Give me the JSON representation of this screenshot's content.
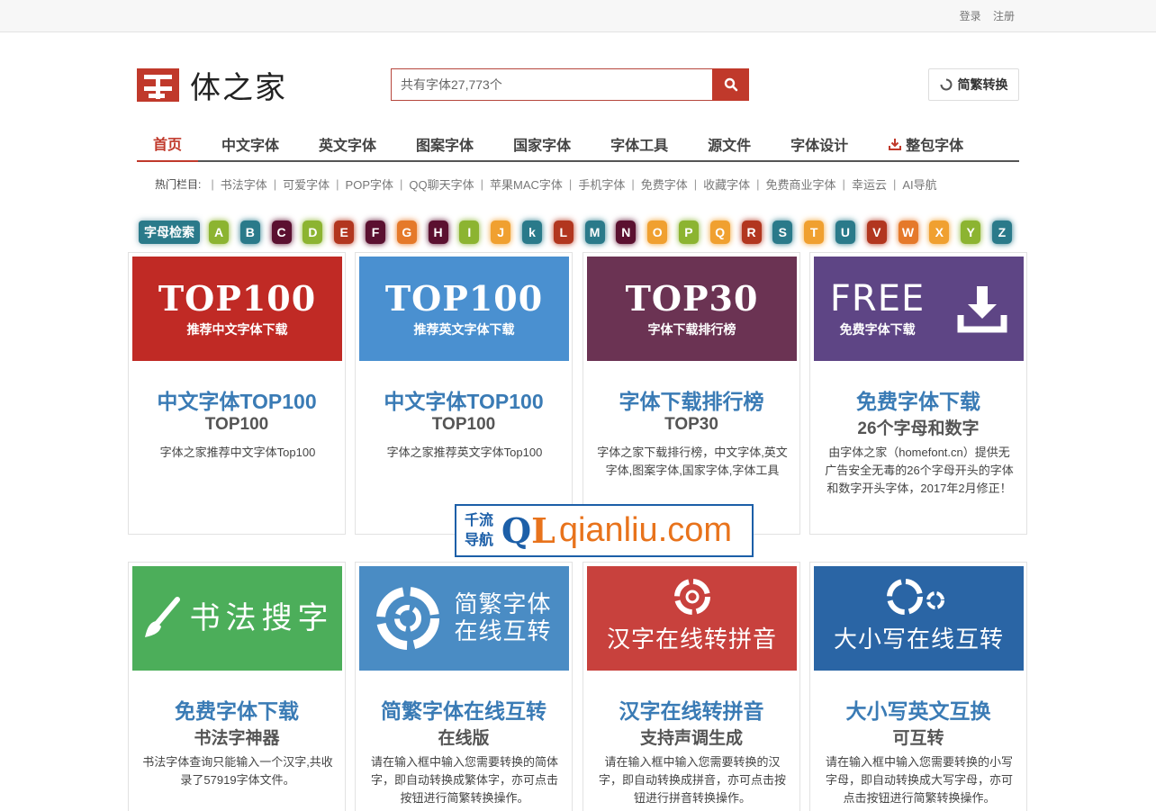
{
  "topbar": {
    "login": "登录",
    "register": "注册"
  },
  "logo": {
    "name": "体之家"
  },
  "search": {
    "placeholder": "共有字体27,773个"
  },
  "convert": {
    "label": "简繁转换"
  },
  "nav": {
    "items": [
      "首页",
      "中文字体",
      "英文字体",
      "图案字体",
      "国家字体",
      "字体工具",
      "源文件",
      "字体设计",
      "整包字体"
    ]
  },
  "hot": {
    "label": "热门栏目:",
    "links": [
      "书法字体",
      "可爱字体",
      "POP字体",
      "QQ聊天字体",
      "苹果MAC字体",
      "手机字体",
      "免费字体",
      "收藏字体",
      "免费商业字体",
      "幸运云",
      "AI导航"
    ]
  },
  "letters": {
    "label": "字母检索",
    "items": [
      {
        "l": "A",
        "c": "#8cb431"
      },
      {
        "l": "B",
        "c": "#2a7a8a"
      },
      {
        "l": "C",
        "c": "#5b1030"
      },
      {
        "l": "D",
        "c": "#8cb431"
      },
      {
        "l": "E",
        "c": "#b2361f"
      },
      {
        "l": "F",
        "c": "#5b1030"
      },
      {
        "l": "G",
        "c": "#e5792a"
      },
      {
        "l": "H",
        "c": "#5b1030"
      },
      {
        "l": "I",
        "c": "#8cb431"
      },
      {
        "l": "J",
        "c": "#f0a030"
      },
      {
        "l": "k",
        "c": "#2a7a8a"
      },
      {
        "l": "L",
        "c": "#b2361f"
      },
      {
        "l": "M",
        "c": "#2a7a8a"
      },
      {
        "l": "N",
        "c": "#5b1030"
      },
      {
        "l": "O",
        "c": "#f0a030"
      },
      {
        "l": "P",
        "c": "#8cb431"
      },
      {
        "l": "Q",
        "c": "#f0a030"
      },
      {
        "l": "R",
        "c": "#b2361f"
      },
      {
        "l": "S",
        "c": "#2a7a8a"
      },
      {
        "l": "T",
        "c": "#f0a030"
      },
      {
        "l": "U",
        "c": "#2a7a8a"
      },
      {
        "l": "V",
        "c": "#b2361f"
      },
      {
        "l": "W",
        "c": "#e5792a"
      },
      {
        "l": "X",
        "c": "#f0a030"
      },
      {
        "l": "Y",
        "c": "#8cb431"
      },
      {
        "l": "Z",
        "c": "#2a7a8a"
      }
    ]
  },
  "cards_row1": [
    {
      "big": "TOP100",
      "small": "推荐中文字体下载",
      "color": "#c02a25",
      "title": "中文字体TOP100",
      "sub": "TOP100",
      "desc": "字体之家推荐中文字体Top100"
    },
    {
      "big": "TOP100",
      "small": "推荐英文字体下载",
      "color": "#4a90d0",
      "title": "中文字体TOP100",
      "sub": "TOP100",
      "desc": "字体之家推荐英文字体Top100"
    },
    {
      "big": "TOP30",
      "small": "字体下载排行榜",
      "color": "#6b3353",
      "title": "字体下载排行榜",
      "sub": "TOP30",
      "desc": "字体之家下载排行榜，中文字体,英文字体,图案字体,国家字体,字体工具"
    },
    {
      "big": "FREE",
      "small": "免费字体下载",
      "color": "#5e4585",
      "title": "免费字体下载",
      "sub": "26个字母和数字",
      "desc": "由字体之家（homefont.cn）提供无广告安全无毒的26个字母开头的字体和数字开头字体，2017年2月修正！"
    }
  ],
  "cards_row2": [
    {
      "big": "书法搜字",
      "color": "#4cae5a",
      "title": "免费字体下载",
      "sub": "书法字神器",
      "desc": "书法字体查询只能输入一个汉字,共收录了57919字体文件。"
    },
    {
      "big": "简繁字体 在线互转",
      "color": "#4a8cc4",
      "title": "简繁字体在线互转",
      "sub": "在线版",
      "desc": "请在输入框中输入您需要转换的简体字，即自动转换成繁体字，亦可点击按钮进行简繁转换操作。"
    },
    {
      "big": "汉字在线转拼音",
      "color": "#c8413d",
      "title": "汉字在线转拼音",
      "sub": "支持声调生成",
      "desc": "请在输入框中输入您需要转换的汉字，即自动转换成拼音，亦可点击按钮进行拼音转换操作。"
    },
    {
      "big": "大小写在线互转",
      "color": "#2a65a5",
      "title": "大小写英文互换",
      "sub": "可互转",
      "desc": "请在输入框中输入您需要转换的小写字母，即自动转换成大写字母，亦可点击按钮进行简繁转换操作。"
    }
  ],
  "watermark": {
    "cn1": "千流",
    "cn2": "导航",
    "q": "Q",
    "l": "L",
    "domain": "qianliu.com"
  }
}
